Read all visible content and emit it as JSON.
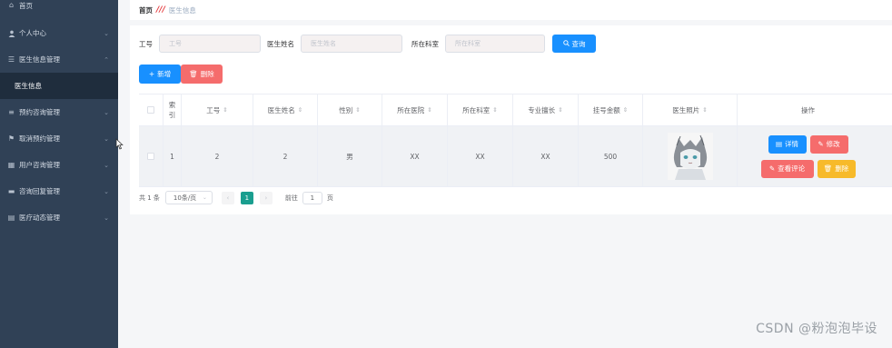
{
  "sidebar": {
    "items": [
      {
        "label": "首页",
        "icon": "home-icon",
        "glyph": "⌂",
        "chevron": false
      },
      {
        "label": "个人中心",
        "icon": "user-icon",
        "glyph": "👤",
        "chevron": true
      },
      {
        "label": "医生信息管理",
        "icon": "menu-icon",
        "glyph": "☰",
        "chevron": true,
        "expanded": true
      },
      {
        "label": "医生信息",
        "icon": "",
        "glyph": "",
        "chevron": false,
        "sub": true
      },
      {
        "label": "预约咨询管理",
        "icon": "list-icon",
        "glyph": "≡",
        "chevron": true
      },
      {
        "label": "取消预约管理",
        "icon": "flag-icon",
        "glyph": "⚑",
        "chevron": true
      },
      {
        "label": "用户咨询管理",
        "icon": "grid-icon",
        "glyph": "▦",
        "chevron": true
      },
      {
        "label": "咨询回复管理",
        "icon": "folder-icon",
        "glyph": "▬",
        "chevron": true
      },
      {
        "label": "医疗动态管理",
        "icon": "document-icon",
        "glyph": "▤",
        "chevron": true
      }
    ]
  },
  "breadcrumb": {
    "home": "首页",
    "sep": "///",
    "current": "医生信息"
  },
  "search": {
    "id_label": "工号",
    "id_placeholder": "工号",
    "name_label": "医生姓名",
    "name_placeholder": "医生姓名",
    "dept_label": "所在科室",
    "dept_placeholder": "所在科室",
    "query_label": "查询"
  },
  "actions": {
    "add_label": "新增",
    "delete_label": "删除"
  },
  "table": {
    "columns": [
      "索引",
      "工号",
      "医生姓名",
      "性别",
      "所在医院",
      "所在科室",
      "专业擅长",
      "挂号金额",
      "医生照片",
      "操作"
    ],
    "rows": [
      {
        "index": "1",
        "id": "2",
        "name": "2",
        "gender": "男",
        "hospital": "XX",
        "dept": "XX",
        "specialty": "XX",
        "fee": "500"
      }
    ],
    "row_actions": {
      "detail": "详情",
      "edit": "修改",
      "comments": "查看评论",
      "delete": "删除"
    }
  },
  "pagination": {
    "total": "共 1 条",
    "page_size": "10条/页",
    "current_page": "1",
    "goto_label": "前往",
    "goto_value": "1",
    "page_suffix": "页"
  },
  "watermark": "CSDN @粉泡泡毕设",
  "colors": {
    "sidebar_bg": "#304156",
    "primary": "#1890ff",
    "danger": "#f56c6c",
    "warning": "#f7ba2a",
    "pager_active": "#1a9e8f"
  }
}
